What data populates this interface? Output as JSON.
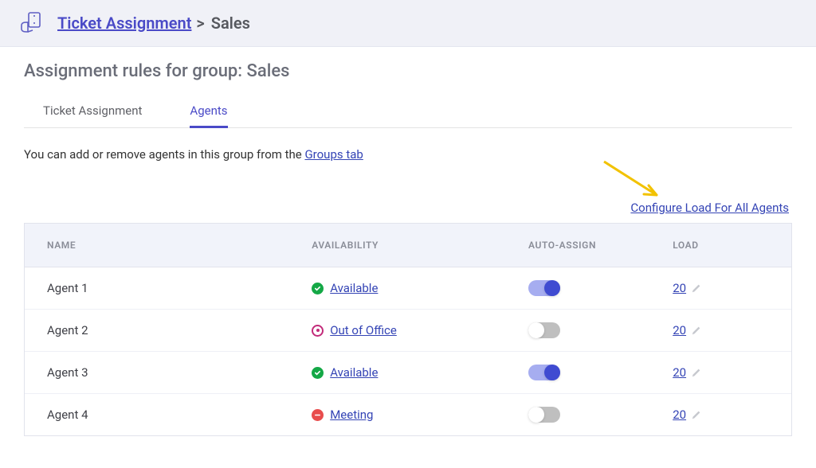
{
  "breadcrumb": {
    "root": "Ticket Assignment",
    "sep": ">",
    "current": "Sales"
  },
  "page_title": "Assignment rules for group: Sales",
  "tabs": [
    {
      "label": "Ticket Assignment",
      "active": false
    },
    {
      "label": "Agents",
      "active": true
    }
  ],
  "hint": {
    "prefix": "You can add or remove agents in this group from the ",
    "link_text": "Groups tab"
  },
  "config_link": "Configure Load For All Agents",
  "table": {
    "headers": {
      "name": "NAME",
      "availability": "AVAILABILITY",
      "auto_assign": "AUTO-ASSIGN",
      "load": "LOAD"
    },
    "rows": [
      {
        "name": "Agent 1",
        "availability": "Available",
        "avail_state": "available",
        "auto_assign": true,
        "load": "20"
      },
      {
        "name": "Agent 2",
        "availability": "Out of Office",
        "avail_state": "away",
        "auto_assign": false,
        "load": "20"
      },
      {
        "name": "Agent 3",
        "availability": "Available",
        "avail_state": "available",
        "auto_assign": true,
        "load": "20"
      },
      {
        "name": "Agent 4",
        "availability": "Meeting",
        "avail_state": "busy",
        "auto_assign": false,
        "load": "20"
      }
    ]
  }
}
